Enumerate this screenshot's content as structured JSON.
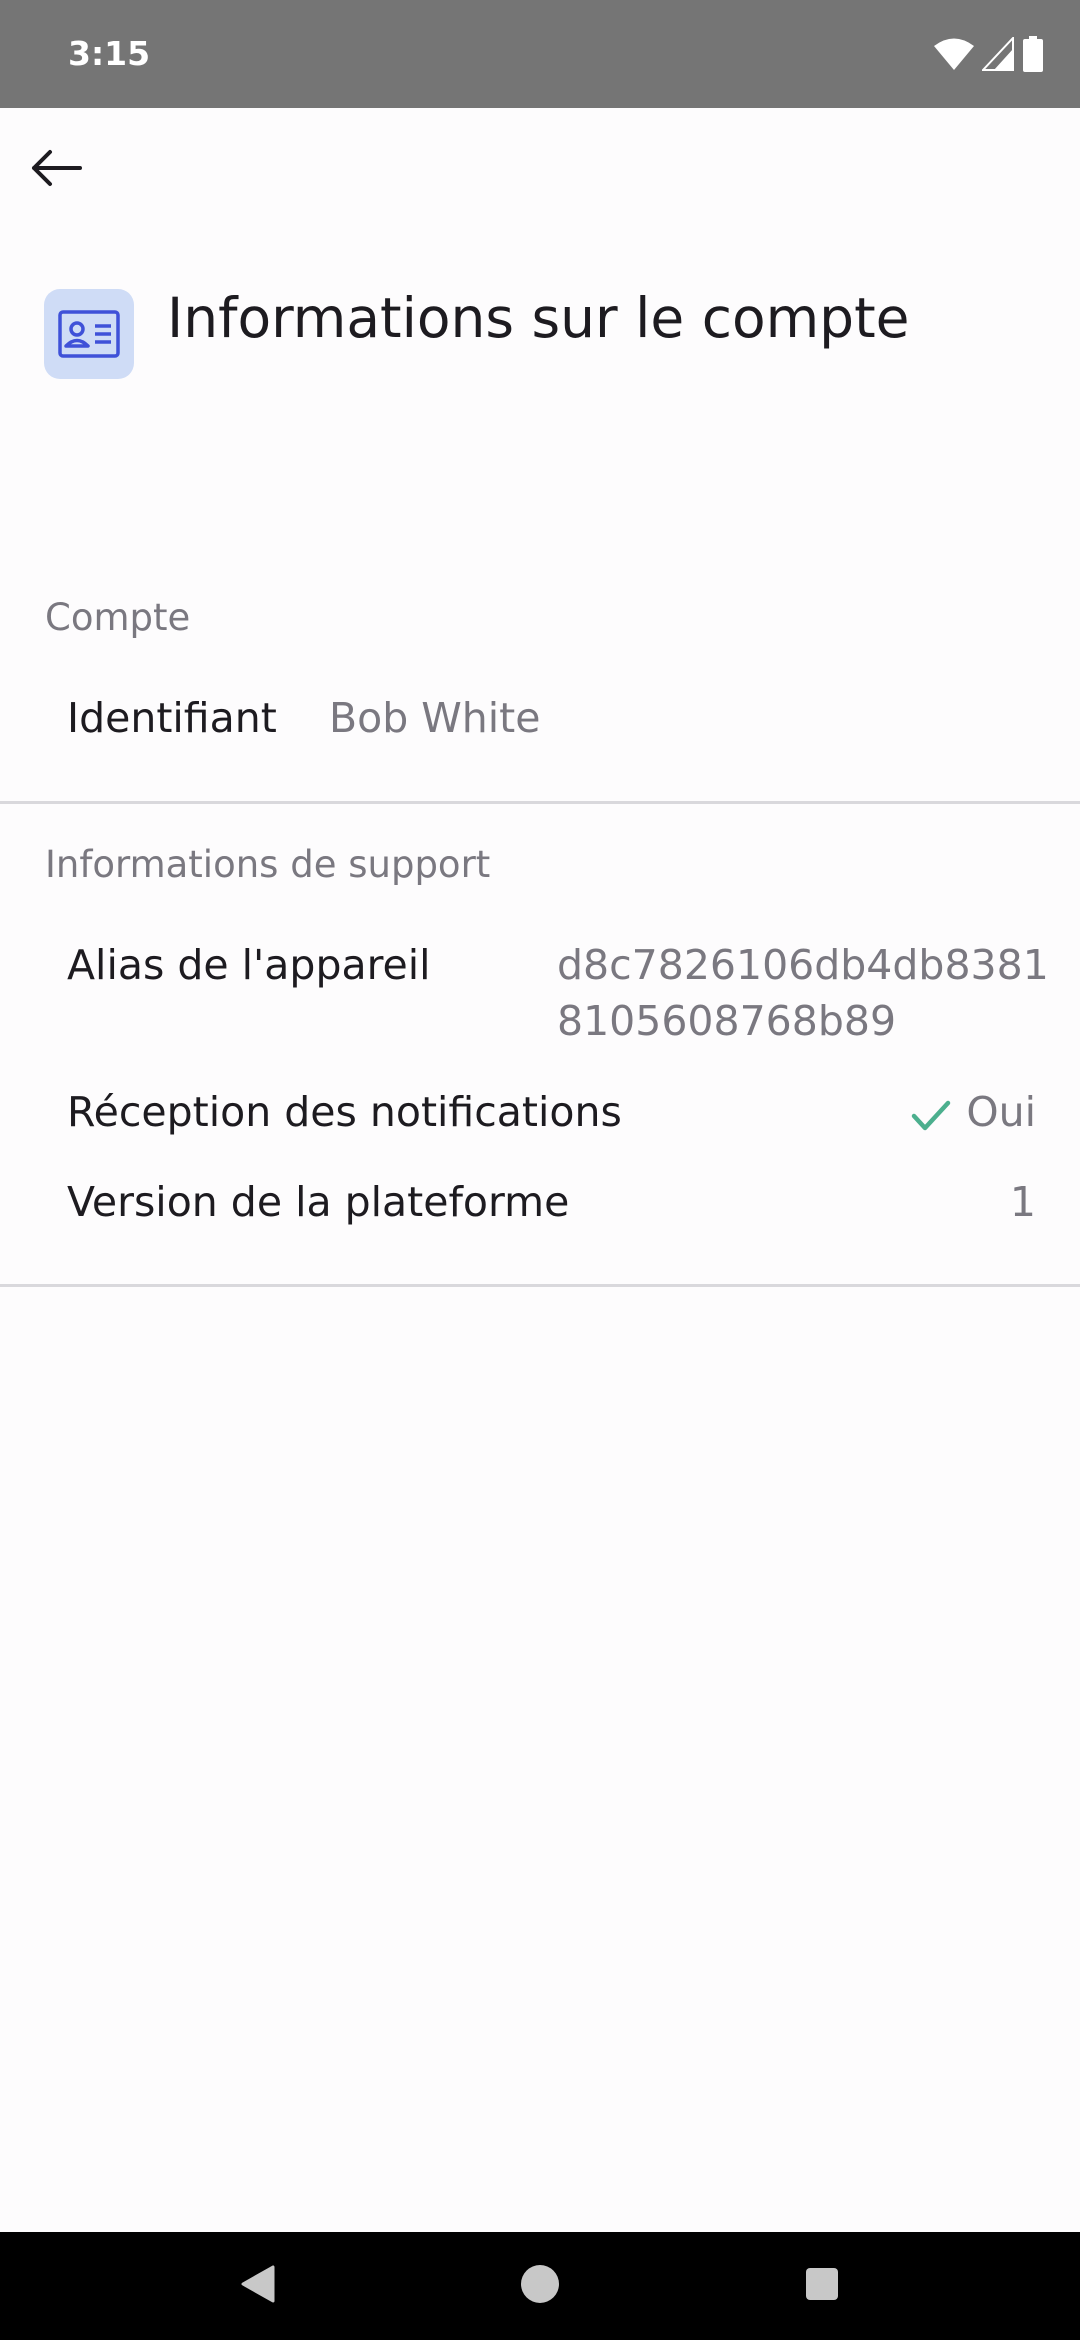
{
  "status_bar": {
    "time": "3:15",
    "icons": [
      "wifi-icon",
      "cellular-signal-icon",
      "battery-icon"
    ]
  },
  "header": {
    "back_icon": "arrow-left-icon",
    "icon": "contact-card-icon",
    "title": "Informations sur le compte"
  },
  "account_section": {
    "label": "Compte",
    "identifier_label": "Identifiant",
    "identifier_value": "Bob White"
  },
  "support_section": {
    "label": "Informations de support",
    "device_alias_label": "Alias de l'appareil",
    "device_alias_line1": "d8c7826106db4db8381",
    "device_alias_line2": "8105608768b89",
    "notifications_label": "Réception des notifications",
    "notifications_value": "Oui",
    "notifications_icon": "check-icon",
    "platform_version_label": "Version de la plateforme",
    "platform_version_value": "1"
  },
  "nav_bar": {
    "icons": [
      "back-triangle-icon",
      "home-circle-icon",
      "recents-square-icon"
    ]
  },
  "colors": {
    "status_bar": "#757575",
    "background": "#fdfcfd",
    "icon_tile": "#cfdcf6",
    "icon_accent": "#3f51d8",
    "check": "#4caf8e",
    "muted_text": "#7a7880"
  }
}
